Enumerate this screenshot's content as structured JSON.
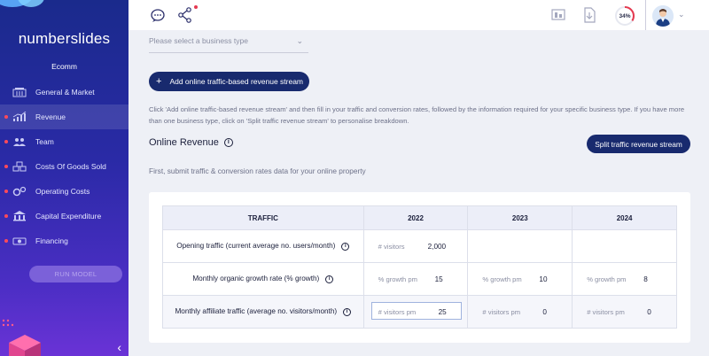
{
  "sidebar": {
    "logo": "numberslides",
    "company": "Ecomm",
    "items": [
      {
        "label": "General & Market",
        "dot": false,
        "active": false,
        "icon": "building-icon"
      },
      {
        "label": "Revenue",
        "dot": true,
        "active": true,
        "icon": "chart-icon"
      },
      {
        "label": "Team",
        "dot": true,
        "active": false,
        "icon": "team-icon"
      },
      {
        "label": "Costs Of Goods Sold",
        "dot": true,
        "active": false,
        "icon": "boxes-icon"
      },
      {
        "label": "Operating Costs",
        "dot": true,
        "active": false,
        "icon": "gears-icon"
      },
      {
        "label": "Capital Expenditure",
        "dot": true,
        "active": false,
        "icon": "bank-icon"
      },
      {
        "label": "Financing",
        "dot": true,
        "active": false,
        "icon": "money-icon"
      }
    ],
    "run_model_label": "RUN MODEL",
    "collapse_glyph": "‹"
  },
  "header": {
    "progress_label": "34%",
    "progress_value": 0.34
  },
  "main": {
    "business_type_placeholder": "Please select a business type",
    "add_stream_label": "Add online traffic-based revenue stream",
    "info_text": "Click 'Add online traffic-based revenue stream' and then fill in your traffic and conversion rates, followed by the information required for your specific business type. If you have more than one business type, click on 'Split traffic revenue stream' to personalise breakdown.",
    "section_title": "Online Revenue",
    "split_label": "Split traffic revenue stream",
    "sub_text": "First, submit traffic & conversion rates data for your online property"
  },
  "table": {
    "headers": [
      "TRAFFIC",
      "2022",
      "2023",
      "2024"
    ],
    "rows": [
      {
        "label": "Opening traffic (current average no. users/month)",
        "cells": [
          {
            "ph": "# visitors",
            "val": "2,000"
          },
          {
            "ph": "",
            "val": ""
          },
          {
            "ph": "",
            "val": ""
          }
        ]
      },
      {
        "label": "Monthly organic growth rate (% growth)",
        "cells": [
          {
            "ph": "% growth pm",
            "val": "15"
          },
          {
            "ph": "% growth pm",
            "val": "10"
          },
          {
            "ph": "% growth pm",
            "val": "8"
          }
        ]
      },
      {
        "label": "Monthly affiliate traffic (average no. visitors/month)",
        "cells": [
          {
            "ph": "# visitors pm",
            "val": "25"
          },
          {
            "ph": "# visitors pm",
            "val": "0"
          },
          {
            "ph": "# visitors pm",
            "val": "0"
          }
        ]
      }
    ]
  },
  "colors": {
    "primary": "#182a6e",
    "sidebar_top": "#1a2a8c",
    "sidebar_bottom": "#6a33d6",
    "alert": "#e53952"
  }
}
